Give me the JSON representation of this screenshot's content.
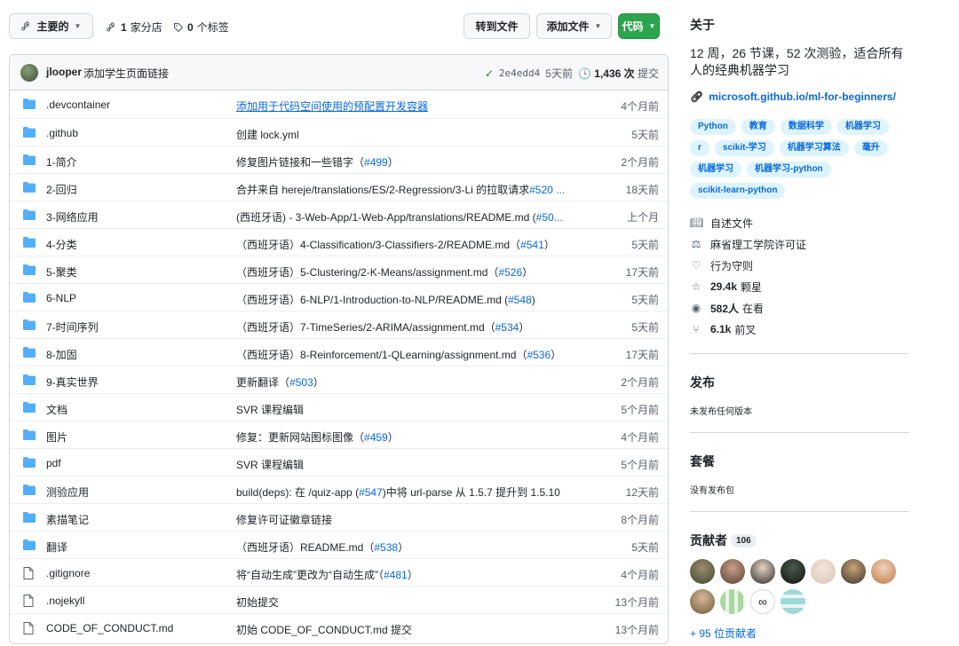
{
  "toolbar": {
    "branch_label": "主要的",
    "branches_count": "1",
    "branches_label": "家分店",
    "tags_count": "0",
    "tags_label": "个标签",
    "goto_label": "转到文件",
    "add_label": "添加文件",
    "code_label": "代码"
  },
  "commit": {
    "author": "jlooper",
    "message": "添加学生页面链接",
    "sha": "2e4edd4",
    "time": "5天前",
    "count": "1,436 次",
    "count_label": "提交"
  },
  "files": [
    {
      "type": "folder",
      "name": ".devcontainer",
      "msg": "添加用于代码空间使用的预配置开发容器",
      "pr": "",
      "suffix": "",
      "link": true,
      "time": "4个月前"
    },
    {
      "type": "folder",
      "name": ".github",
      "msg": "创建 lock.yml",
      "pr": "",
      "suffix": "",
      "link": false,
      "time": "5天前"
    },
    {
      "type": "folder",
      "name": "1-简介",
      "msg": "修复图片链接和一些错字（",
      "pr": "#499",
      "suffix": "）",
      "link": false,
      "time": "2个月前"
    },
    {
      "type": "folder",
      "name": "2-回归",
      "msg": "合并来自 hereje/translations/ES/2-Regression/3-Li 的拉取请求",
      "pr": "#520 ...",
      "suffix": "",
      "link": false,
      "time": "18天前"
    },
    {
      "type": "folder",
      "name": "3-网络应用",
      "msg": "(西班牙语) - 3-Web-App/1-Web-App/translations/README.md (",
      "pr": "#50...",
      "suffix": "",
      "link": false,
      "time": "上个月"
    },
    {
      "type": "folder",
      "name": "4-分类",
      "msg": "（西班牙语）4-Classification/3-Classifiers-2/README.md（",
      "pr": "#541",
      "suffix": "）",
      "link": false,
      "time": "5天前"
    },
    {
      "type": "folder",
      "name": "5-聚类",
      "msg": "（西班牙语）5-Clustering/2-K-Means/assignment.md（",
      "pr": "#526",
      "suffix": "）",
      "link": false,
      "time": "17天前"
    },
    {
      "type": "folder",
      "name": "6-NLP",
      "msg": "（西班牙语）6-NLP/1-Introduction-to-NLP/README.md (",
      "pr": "#548",
      "suffix": ")",
      "link": false,
      "time": "5天前"
    },
    {
      "type": "folder",
      "name": "7-时间序列",
      "msg": "（西班牙语）7-TimeSeries/2-ARIMA/assignment.md（",
      "pr": "#534",
      "suffix": "）",
      "link": false,
      "time": "5天前"
    },
    {
      "type": "folder",
      "name": "8-加固",
      "msg": "（西班牙语）8-Reinforcement/1-QLearning/assignment.md（",
      "pr": "#536",
      "suffix": "）",
      "link": false,
      "time": "17天前"
    },
    {
      "type": "folder",
      "name": "9-真实世界",
      "msg": "更新翻译（",
      "pr": "#503",
      "suffix": "）",
      "link": false,
      "time": "2个月前"
    },
    {
      "type": "folder",
      "name": "文档",
      "msg": "SVR 课程编辑",
      "pr": "",
      "suffix": "",
      "link": false,
      "time": "5个月前"
    },
    {
      "type": "folder",
      "name": "图片",
      "msg": "修复：更新网站图标图像（",
      "pr": "#459",
      "suffix": "）",
      "link": false,
      "time": "4个月前"
    },
    {
      "type": "folder",
      "name": "pdf",
      "msg": "SVR 课程编辑",
      "pr": "",
      "suffix": "",
      "link": false,
      "time": "5个月前"
    },
    {
      "type": "folder",
      "name": "测验应用",
      "msg": "build(deps): 在 /quiz-app (",
      "pr": "#547",
      "suffix": ")中将 url-parse 从 1.5.7 提升到 1.5.10",
      "link": false,
      "time": "12天前"
    },
    {
      "type": "folder",
      "name": "素描笔记",
      "msg": "修复许可证徽章链接",
      "pr": "",
      "suffix": "",
      "link": false,
      "time": "8个月前"
    },
    {
      "type": "folder",
      "name": "翻译",
      "msg": "（西班牙语）README.md（",
      "pr": "#538",
      "suffix": "）",
      "link": false,
      "time": "5天前"
    },
    {
      "type": "file",
      "name": ".gitignore",
      "msg": "将“自动生成”更改为“自动生成”（",
      "pr": "#481",
      "suffix": "）",
      "link": false,
      "time": "4个月前"
    },
    {
      "type": "file",
      "name": ".nojekyll",
      "msg": "初始提交",
      "pr": "",
      "suffix": "",
      "link": false,
      "time": "13个月前"
    },
    {
      "type": "file",
      "name": "CODE_OF_CONDUCT.md",
      "msg": "初始 CODE_OF_CONDUCT.md 提交",
      "pr": "",
      "suffix": "",
      "link": false,
      "time": "13个月前"
    }
  ],
  "about": {
    "title": "关于",
    "description": "12 周，26 节课，52 次测验，适合所有人的经典机器学习",
    "url": "microsoft.github.io/ml-for-beginners/",
    "topics": [
      "Python",
      "教育",
      "数据科学",
      "机器学习",
      "r",
      "scikit-学习",
      "机器学习算法",
      "毫升",
      "机器学习",
      "机器学习-python",
      "scikit-learn-python"
    ],
    "readme": "自述文件",
    "license": "麻省理工学院许可证",
    "conduct": "行为守则",
    "stars_count": "29.4k",
    "stars_label": "颗星",
    "watch_count": "582人",
    "watch_label": "在看",
    "forks_count": "6.1k",
    "forks_label": "前叉"
  },
  "releases": {
    "title": "发布",
    "empty": "未发布任何版本"
  },
  "packages": {
    "title": "套餐",
    "empty": "没有发布包"
  },
  "contributors": {
    "title": "贡献者",
    "count": "106",
    "more": "+ 95 位贡献者"
  },
  "colors": {
    "folder": "#54aeff",
    "link": "#0969da",
    "green": "#2da44e"
  }
}
